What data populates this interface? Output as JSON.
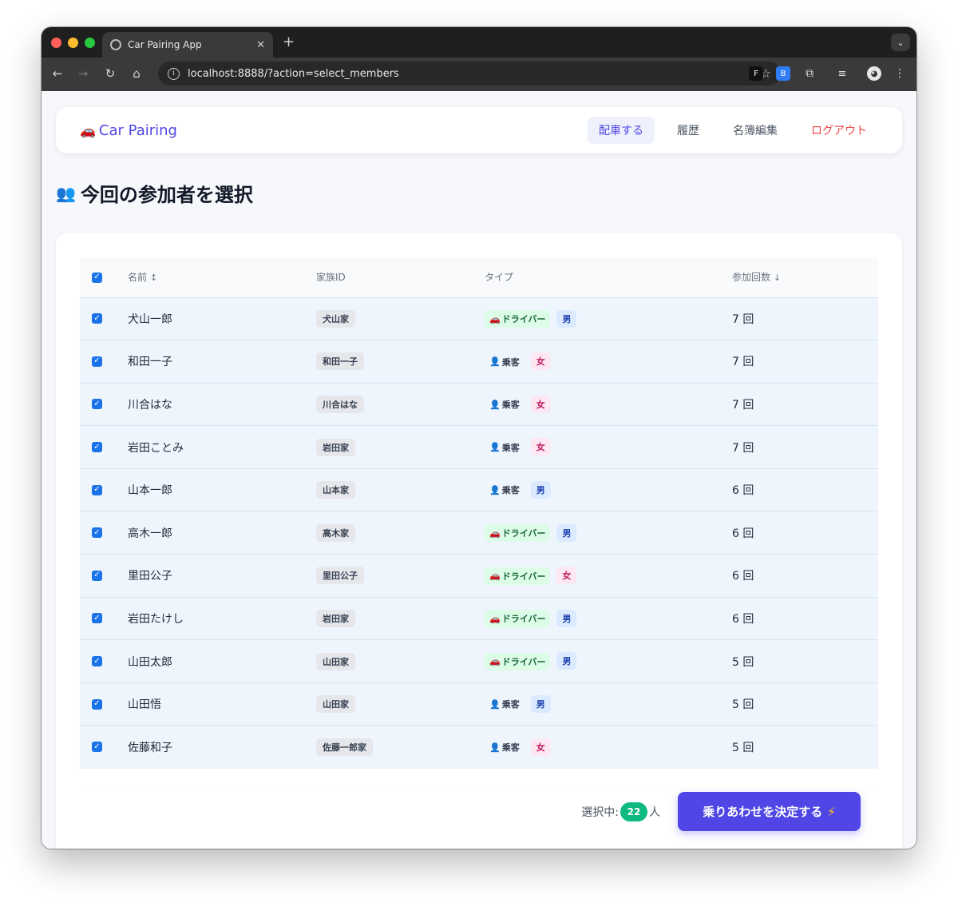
{
  "browser": {
    "tab_title": "Car Pairing App",
    "url": "localhost:8888/?action=select_members"
  },
  "nav": {
    "brand": "Car Pairing",
    "links": [
      "配車する",
      "履歴",
      "名簿編集",
      "ログアウト"
    ]
  },
  "page": {
    "title": "今回の参加者を選択"
  },
  "table": {
    "headers": {
      "name": "名前",
      "family": "家族ID",
      "type": "タイプ",
      "count": "参加回数"
    },
    "rows": [
      {
        "name": "犬山一郎",
        "family": "犬山家",
        "type": "ドライバー",
        "gender": "男",
        "count": "7 回"
      },
      {
        "name": "和田一子",
        "family": "和田一子",
        "type": "乗客",
        "gender": "女",
        "count": "7 回"
      },
      {
        "name": "川合はな",
        "family": "川合はな",
        "type": "乗客",
        "gender": "女",
        "count": "7 回"
      },
      {
        "name": "岩田ことみ",
        "family": "岩田家",
        "type": "乗客",
        "gender": "女",
        "count": "7 回"
      },
      {
        "name": "山本一郎",
        "family": "山本家",
        "type": "乗客",
        "gender": "男",
        "count": "6 回"
      },
      {
        "name": "高木一郎",
        "family": "高木家",
        "type": "ドライバー",
        "gender": "男",
        "count": "6 回"
      },
      {
        "name": "里田公子",
        "family": "里田公子",
        "type": "ドライバー",
        "gender": "女",
        "count": "6 回"
      },
      {
        "name": "岩田たけし",
        "family": "岩田家",
        "type": "ドライバー",
        "gender": "男",
        "count": "6 回"
      },
      {
        "name": "山田太郎",
        "family": "山田家",
        "type": "ドライバー",
        "gender": "男",
        "count": "5 回"
      },
      {
        "name": "山田悟",
        "family": "山田家",
        "type": "乗客",
        "gender": "男",
        "count": "5 回"
      },
      {
        "name": "佐藤和子",
        "family": "佐藤一郎家",
        "type": "乗客",
        "gender": "女",
        "count": "5 回"
      }
    ]
  },
  "footer": {
    "selected_label": "選択中:",
    "selected_count": "22",
    "selected_unit": "人",
    "decide_label": "乗りあわせを決定する"
  },
  "colors": {
    "accent": "#4f46e5",
    "logout": "#ef4444",
    "count_pill": "#10b981",
    "driver_badge": "#dcfce7",
    "male_badge": "#dbeafe",
    "female_badge": "#fce7f3"
  }
}
